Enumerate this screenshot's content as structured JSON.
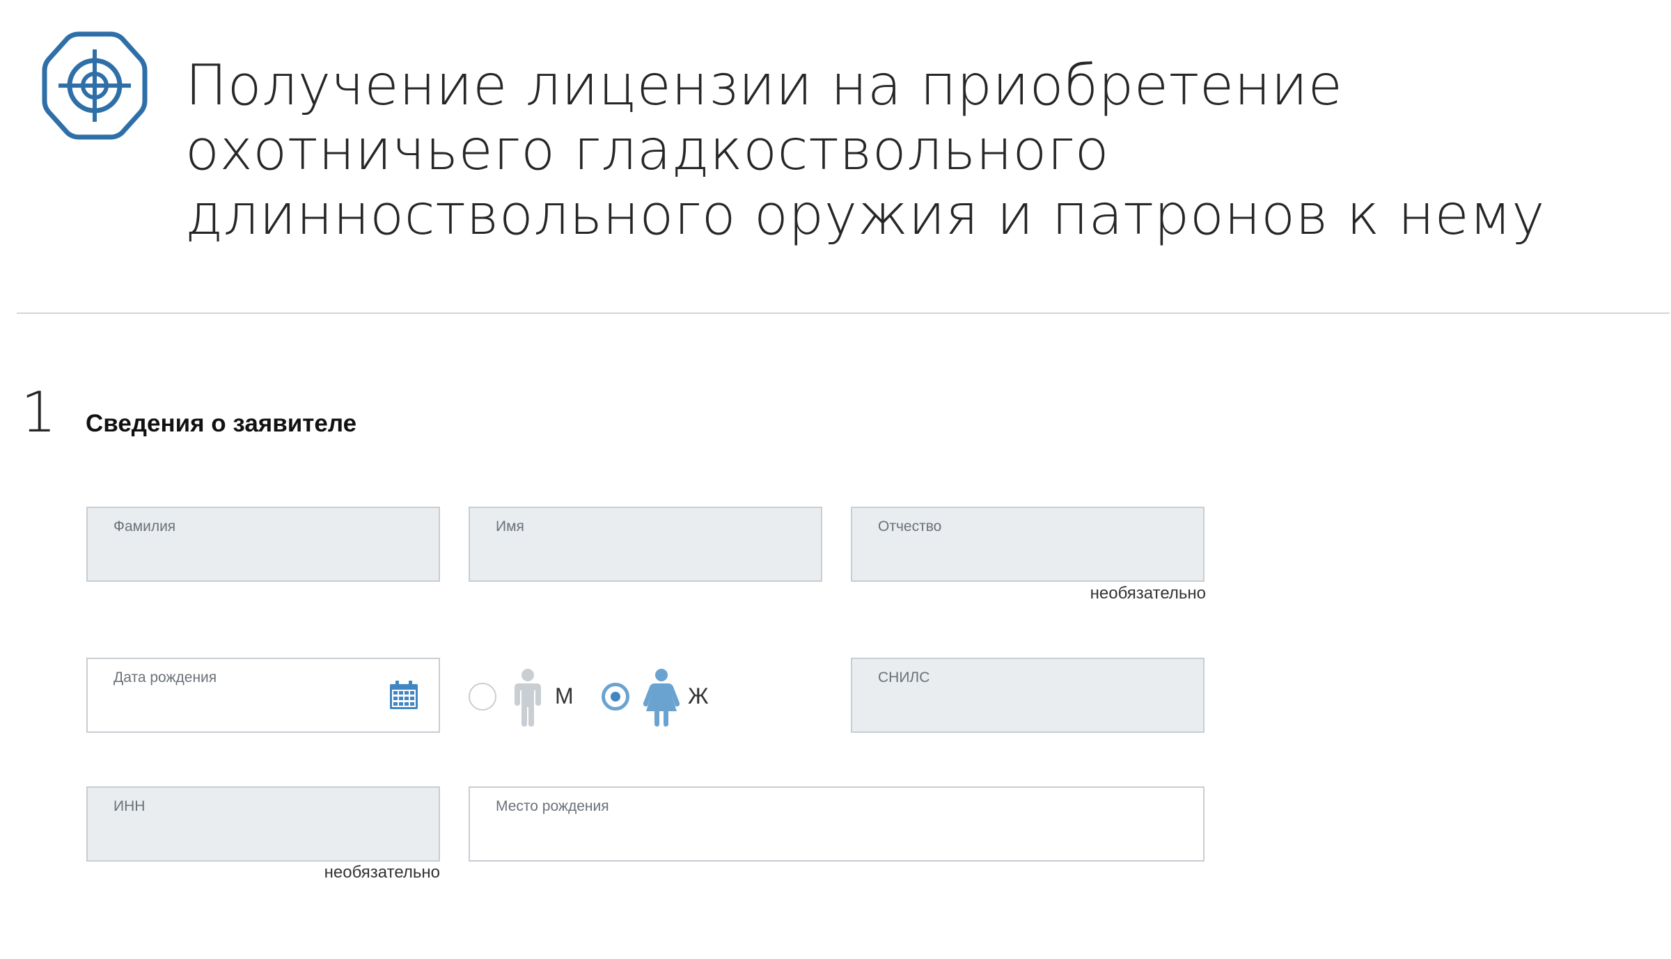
{
  "page": {
    "title": "Получение лицензии на приобретение охотничьего гладкоствольного длинноствольного оружия и патронов к нему",
    "icon": "crosshair-icon",
    "accent_color": "#2e6fa8"
  },
  "step": {
    "number": "1",
    "title": "Сведения о заявителе"
  },
  "form": {
    "last_name": {
      "label": "Фамилия",
      "value": ""
    },
    "first_name": {
      "label": "Имя",
      "value": ""
    },
    "middle_name": {
      "label": "Отчество",
      "value": "",
      "note": "необязательно"
    },
    "birth_date": {
      "label": "Дата рождения",
      "value": "",
      "icon": "calendar-icon"
    },
    "gender": {
      "options": [
        {
          "label": "М",
          "icon": "male-person-icon",
          "selected": false
        },
        {
          "label": "Ж",
          "icon": "female-person-icon",
          "selected": true
        }
      ]
    },
    "snils": {
      "label": "СНИЛС",
      "value": ""
    },
    "inn": {
      "label": "ИНН",
      "value": "",
      "note": "необязательно"
    },
    "birth_place": {
      "label": "Место рождения",
      "value": ""
    }
  },
  "colors": {
    "field_background": "#e9edf0",
    "field_border": "#c8cdd2",
    "radio_selected": "#3f86c2",
    "female_icon": "#6aa3d0",
    "male_icon": "#c9ced3"
  }
}
